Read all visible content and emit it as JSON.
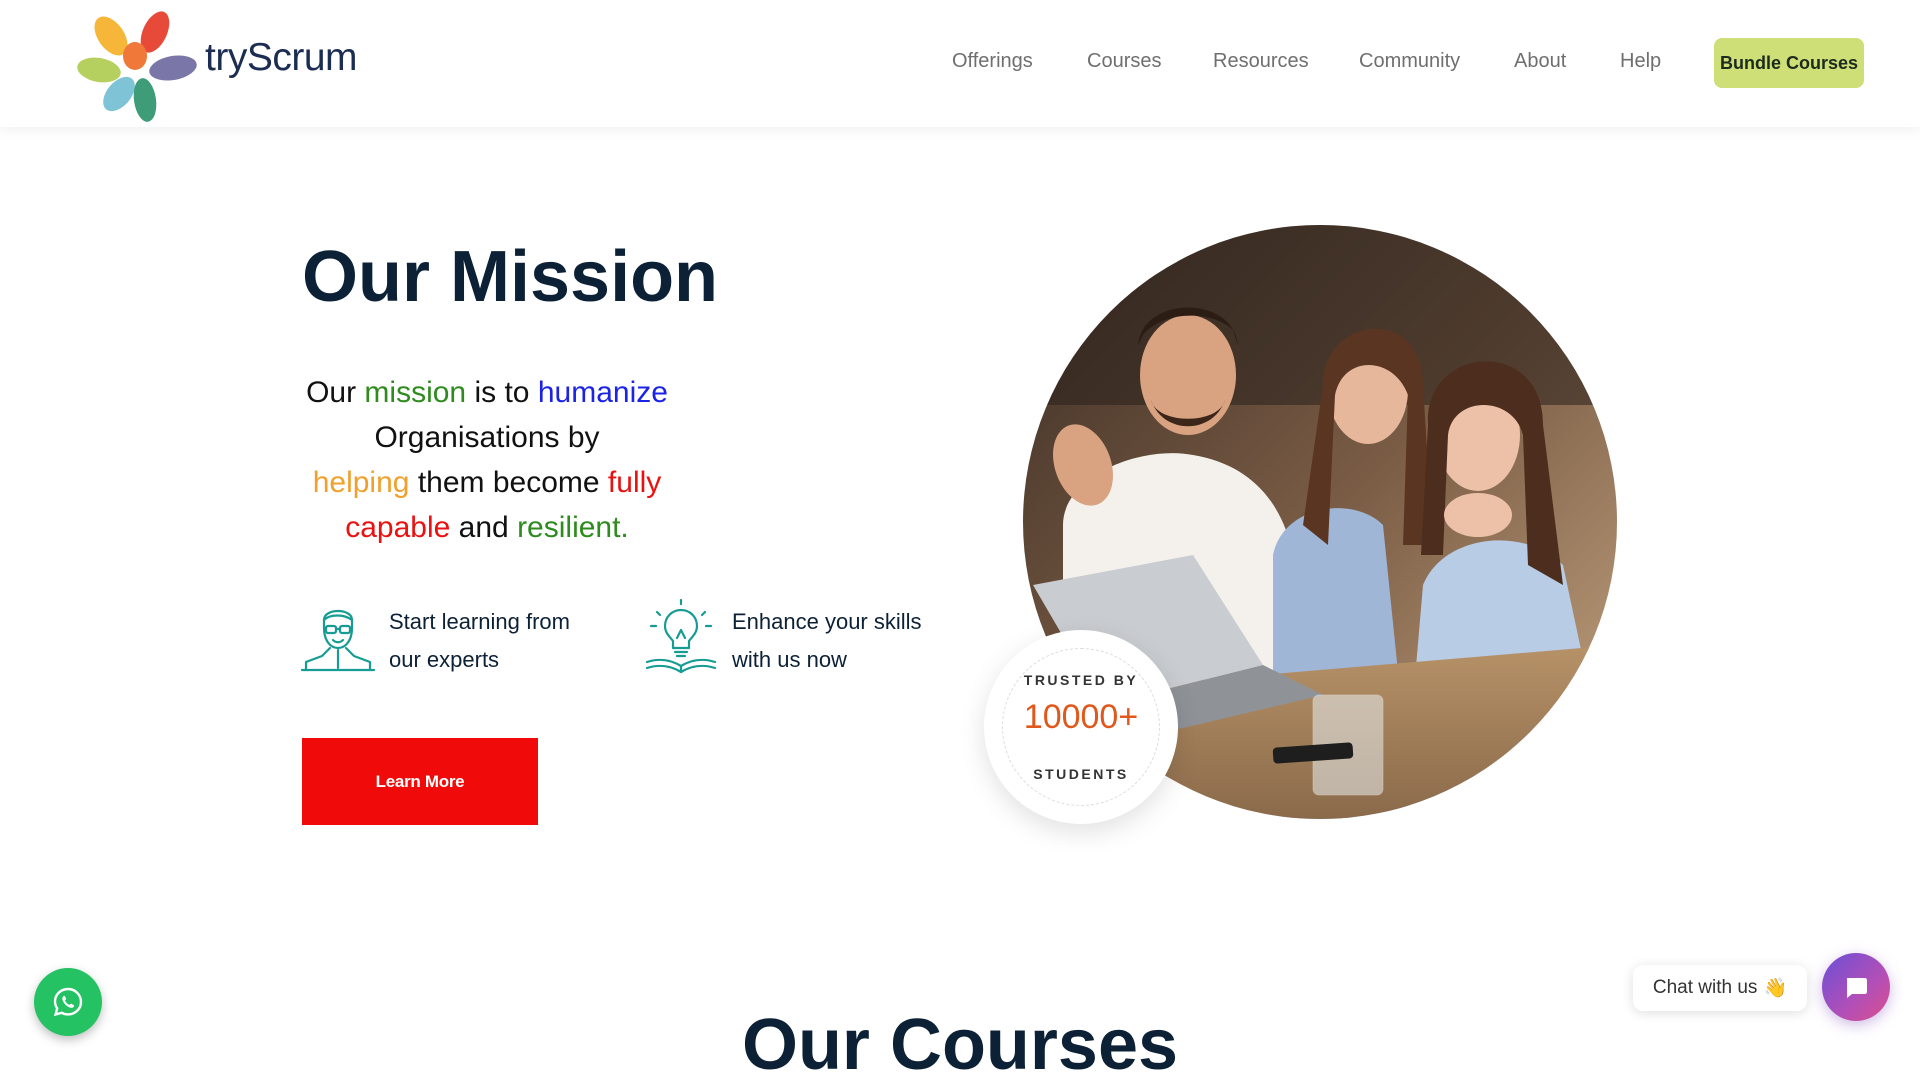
{
  "header": {
    "brand": "tryScrum",
    "nav": [
      {
        "label": "Offerings"
      },
      {
        "label": "Courses"
      },
      {
        "label": "Resources"
      },
      {
        "label": "Community"
      },
      {
        "label": "About"
      },
      {
        "label": "Help"
      }
    ],
    "cta_label": "Bundle Courses"
  },
  "mission": {
    "title": "Our Mission",
    "text": {
      "w1": "Our",
      "w2": "mission",
      "w3": "is to",
      "w4": "humanize",
      "w5": "Organisations by",
      "w6": "helping",
      "w7": "them become",
      "w8": "fully",
      "w9": "capable",
      "w10": "and",
      "w11": "resilient."
    },
    "features": [
      {
        "line1": "Start learning from",
        "line2": "our experts",
        "icon": "expert-person-icon"
      },
      {
        "line1": "Enhance your skills",
        "line2": "with us now",
        "icon": "lightbulb-book-icon"
      }
    ],
    "button_label": "Learn More"
  },
  "badge": {
    "top": "TRUSTED BY",
    "number": "10000+",
    "bottom": "STUDENTS"
  },
  "courses": {
    "title": "Our Courses"
  },
  "chat": {
    "label": "Chat with us",
    "emoji": "👋"
  },
  "colors": {
    "green": "#2e8b1d",
    "blue": "#1a23e6",
    "orange": "#f0a02d",
    "red": "#ea1111",
    "cta": "#cddf76",
    "learn_more": "#f00a0a",
    "teal_icon": "#169c92"
  }
}
